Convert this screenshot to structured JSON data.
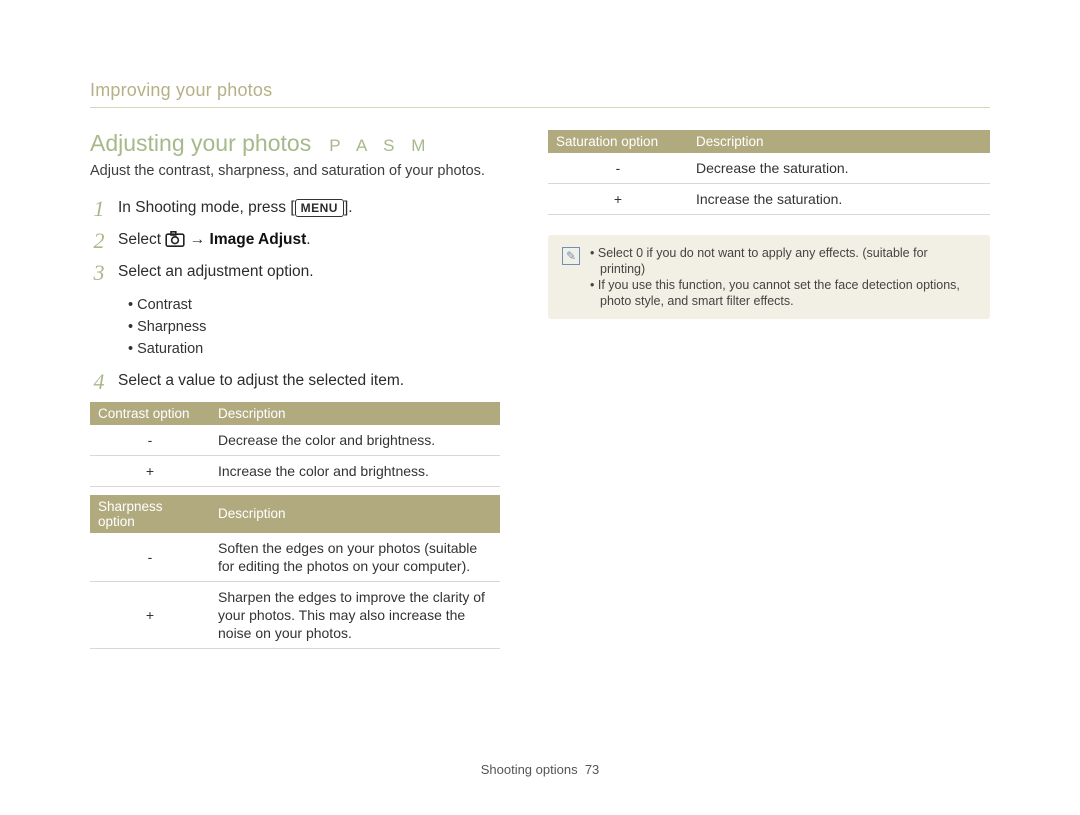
{
  "breadcrumb": "Improving your photos",
  "section_title": "Adjusting your photos",
  "mode_badge": "P A S M",
  "intro": "Adjust the contrast, sharpness, and saturation of your photos.",
  "steps": {
    "s1_pre": "In Shooting mode, press [",
    "s1_key": "MENU",
    "s1_post": "].",
    "s2_pre": "Select ",
    "s2_arrow": " → ",
    "s2_bold": "Image Adjust",
    "s2_post": ".",
    "s3": "Select an adjustment option.",
    "s4": "Select a value to adjust the selected item."
  },
  "bullets": [
    "Contrast",
    "Sharpness",
    "Saturation"
  ],
  "tables": {
    "contrast": {
      "headers": [
        "Contrast option",
        "Description"
      ],
      "rows": [
        {
          "opt": "-",
          "desc": "Decrease the color and brightness."
        },
        {
          "opt": "+",
          "desc": "Increase the color and brightness."
        }
      ]
    },
    "sharpness": {
      "headers": [
        "Sharpness option",
        "Description"
      ],
      "rows": [
        {
          "opt": "-",
          "desc": "Soften the edges on your photos (suitable for editing the photos on your computer)."
        },
        {
          "opt": "+",
          "desc": "Sharpen the edges to improve the clarity of your photos. This may also increase the noise on your photos."
        }
      ]
    },
    "saturation": {
      "headers": [
        "Saturation option",
        "Description"
      ],
      "rows": [
        {
          "opt": "-",
          "desc": "Decrease the saturation."
        },
        {
          "opt": "+",
          "desc": "Increase the saturation."
        }
      ]
    }
  },
  "note": {
    "icon_glyph": "✎",
    "items": [
      "Select 0 if you do not want to apply any effects. (suitable for printing)",
      "If you use this function, you cannot set the face detection options, photo style, and smart filter effects."
    ],
    "bold0": "0"
  },
  "footer": {
    "section": "Shooting options",
    "page": "73"
  }
}
